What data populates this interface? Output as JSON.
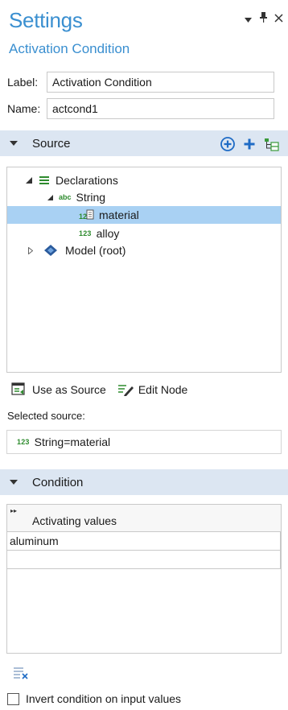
{
  "window": {
    "title": "Settings",
    "subtitle": "Activation Condition"
  },
  "fields": {
    "label_caption": "Label:",
    "label_value": "Activation Condition",
    "name_caption": "Name:",
    "name_value": "actcond1"
  },
  "source_section": {
    "title": "Source",
    "tree": {
      "declarations": "Declarations",
      "string": "String",
      "abc_badge": "abc",
      "material": "material",
      "alloy": "alloy",
      "num_badge": "123",
      "model_root": "Model (root)"
    },
    "use_as_source": "Use as Source",
    "edit_node": "Edit Node",
    "selected_source_label": "Selected source:",
    "selected_source_badge": "123",
    "selected_source_value": "String=material"
  },
  "condition_section": {
    "title": "Condition",
    "column_header": "Activating values",
    "rows": [
      "aluminum",
      ""
    ],
    "invert_label": "Invert condition on input values"
  },
  "colors": {
    "accent": "#3a8fd0",
    "section_header_bg": "#dce6f2",
    "selected_row": "#a9d1f3",
    "badge_green": "#2e8b2e"
  }
}
